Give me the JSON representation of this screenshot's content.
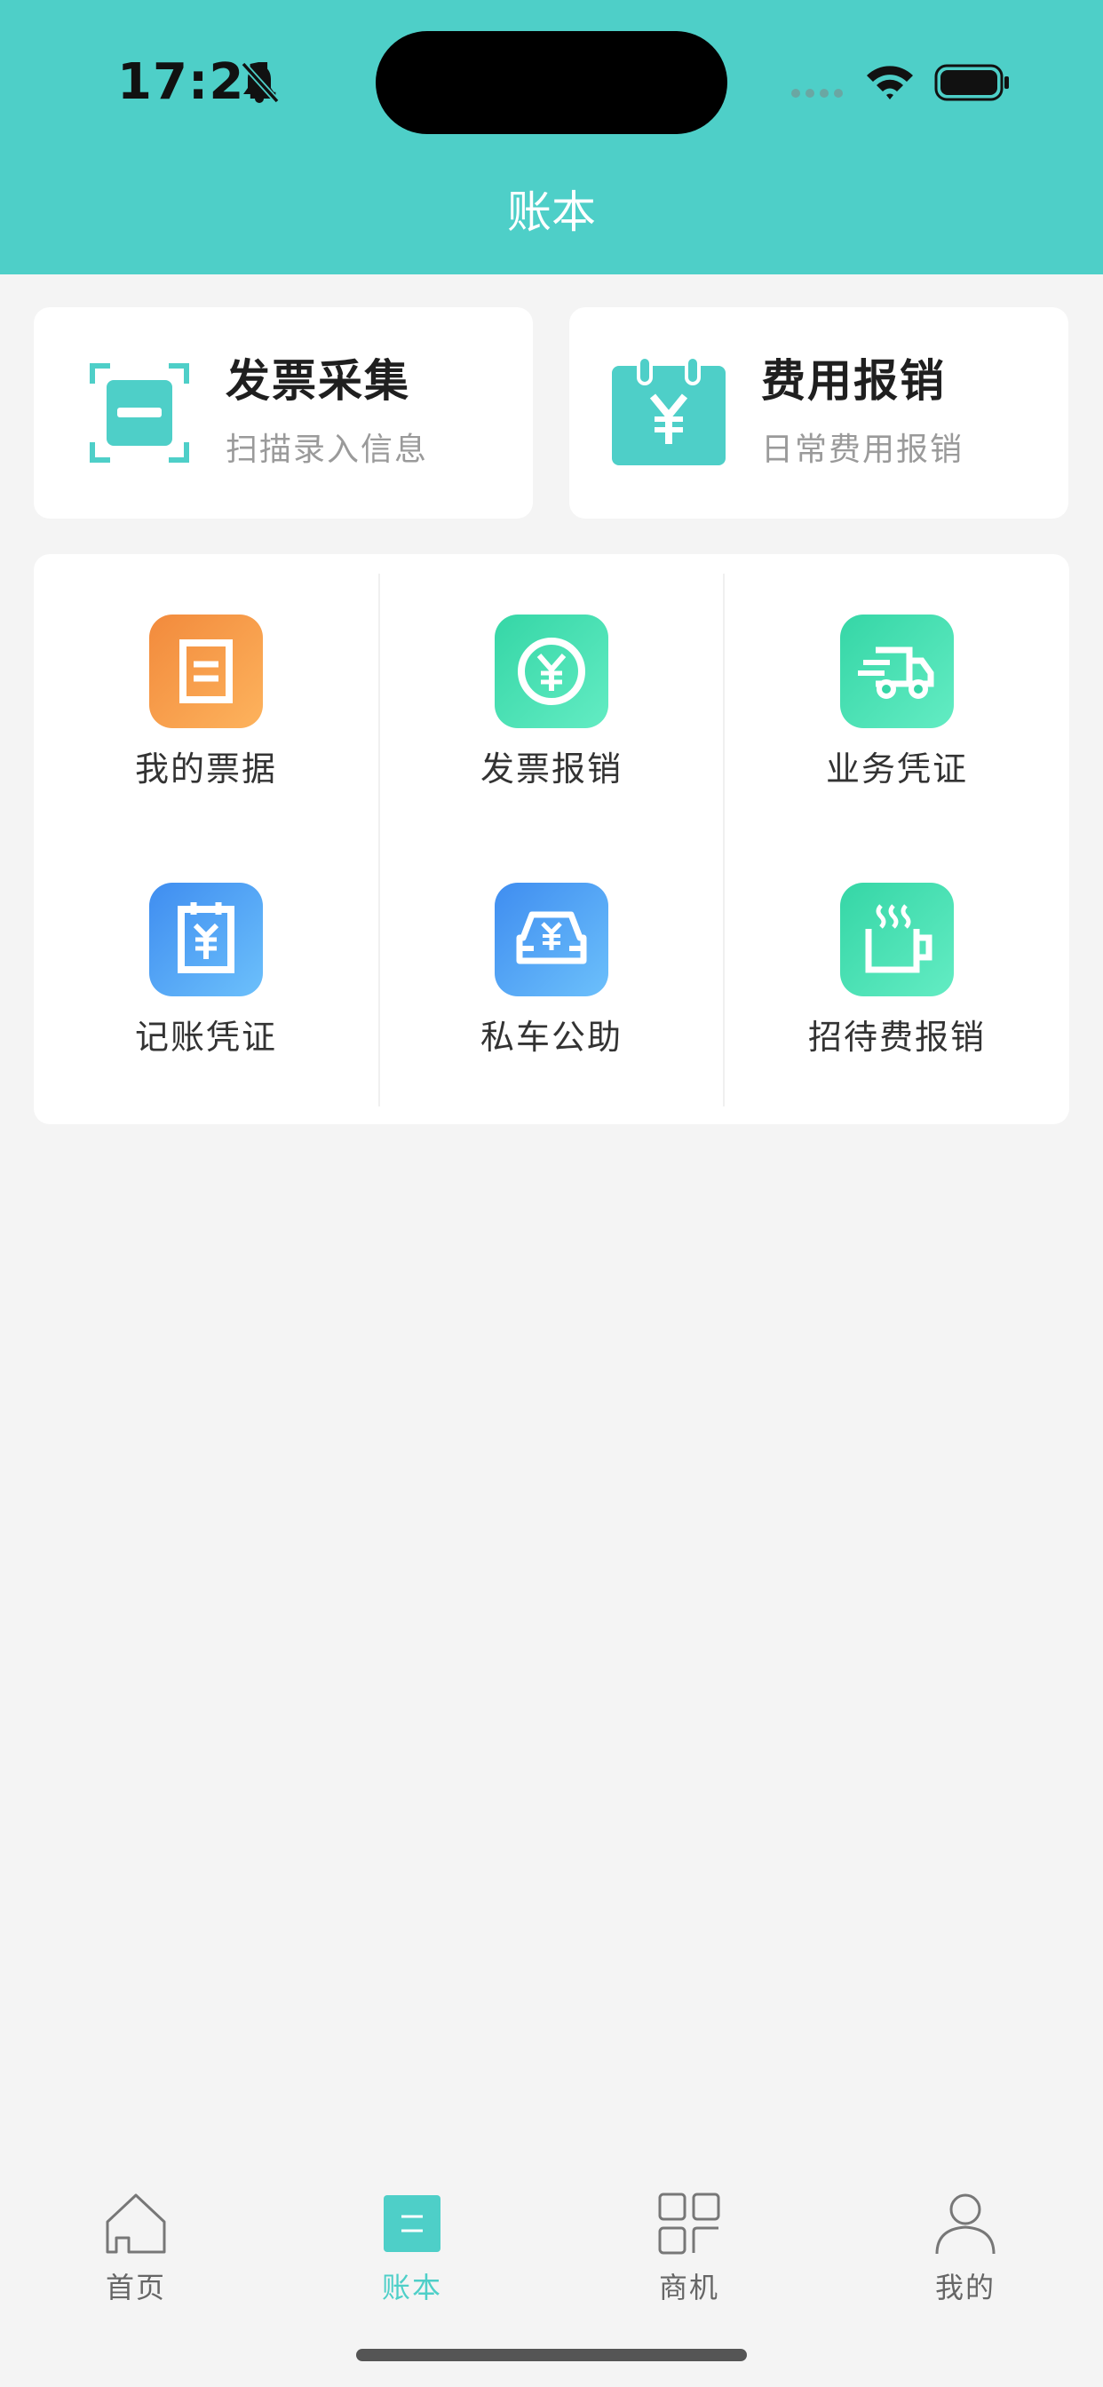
{
  "status_bar": {
    "time": "17:21",
    "icons": [
      "bell-muted-icon",
      "cellular-signal-icon",
      "wifi-icon",
      "battery-icon"
    ]
  },
  "header": {
    "title": "账本",
    "background_color": "#4ecfc8"
  },
  "top_cards": [
    {
      "title": "发票采集",
      "subtitle": "扫描录入信息",
      "icon": "scan-icon"
    },
    {
      "title": "费用报销",
      "subtitle": "日常费用报销",
      "icon": "calendar-yuan-icon"
    }
  ],
  "grid_items": [
    {
      "label": "我的票据",
      "icon": "receipt-icon",
      "color": "#f28a3c"
    },
    {
      "label": "发票报销",
      "icon": "yuan-coin-icon",
      "color": "#35d6a6"
    },
    {
      "label": "业务凭证",
      "icon": "delivery-truck-icon",
      "color": "#35d6a6"
    },
    {
      "label": "记账凭证",
      "icon": "ledger-yuan-icon",
      "color": "#3f8df0"
    },
    {
      "label": "私车公助",
      "icon": "car-yuan-icon",
      "color": "#3f8df0"
    },
    {
      "label": "招待费报销",
      "icon": "hot-cup-icon",
      "color": "#35d6a6"
    }
  ],
  "tabbar": {
    "active_tab": "账本",
    "accent_color": "#4ecfc8",
    "tabs": [
      {
        "label": "首页",
        "icon": "home-icon"
      },
      {
        "label": "账本",
        "icon": "ledger-icon"
      },
      {
        "label": "商机",
        "icon": "grid-icon"
      },
      {
        "label": "我的",
        "icon": "person-icon"
      }
    ]
  }
}
